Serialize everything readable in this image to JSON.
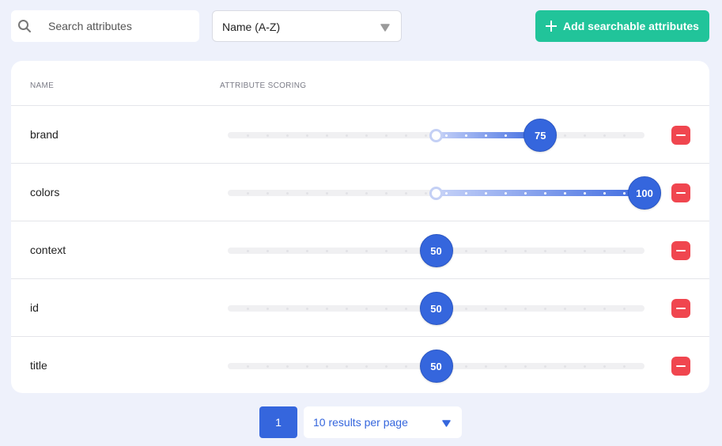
{
  "search": {
    "placeholder": "Search attributes",
    "icon": "search-icon"
  },
  "sort": {
    "selected": "Name (A-Z)"
  },
  "add_button": {
    "label": "Add searchable attributes",
    "icon": "plus-icon"
  },
  "table": {
    "columns": {
      "name": "NAME",
      "scoring": "ATTRIBUTE SCORING"
    },
    "rows": [
      {
        "name": "brand",
        "score": "75",
        "value": 75
      },
      {
        "name": "colors",
        "score": "100",
        "value": 100
      },
      {
        "name": "context",
        "score": "50",
        "value": 50
      },
      {
        "name": "id",
        "score": "50",
        "value": 50
      },
      {
        "name": "title",
        "score": "50",
        "value": 50
      }
    ]
  },
  "pagination": {
    "page": "1",
    "per_page": "10 results per page"
  },
  "colors": {
    "accent": "#3566dd",
    "add_button": "#21c49a",
    "remove": "#f0464f",
    "background": "#eef1fb"
  }
}
